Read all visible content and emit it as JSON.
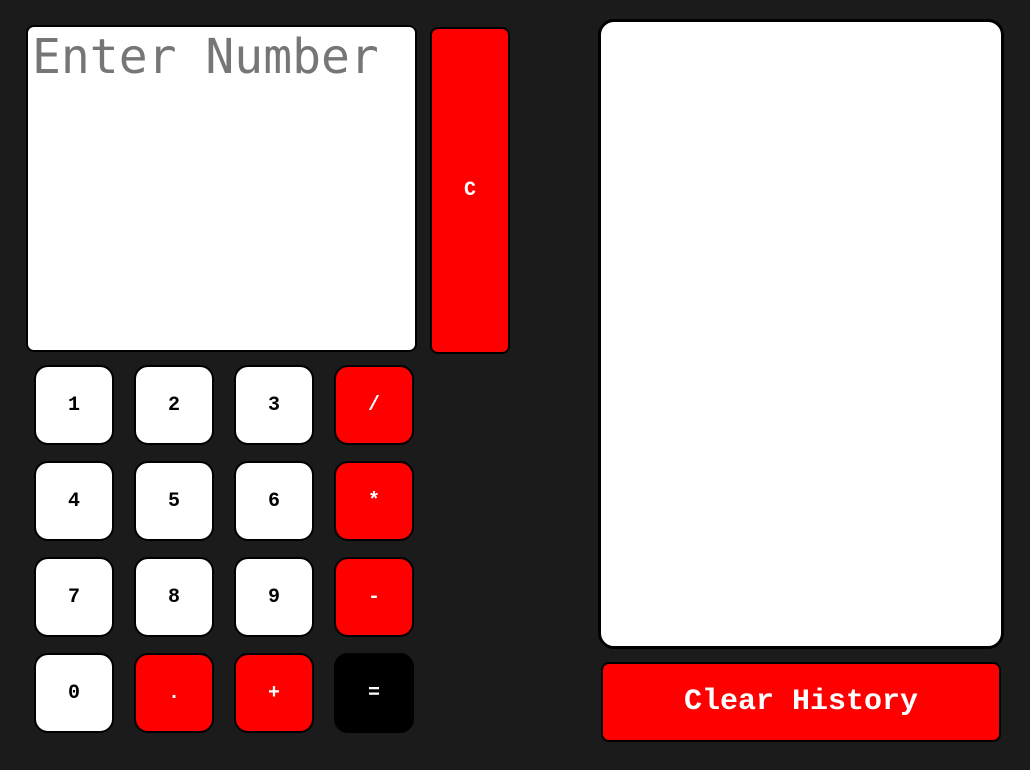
{
  "display": {
    "value": "",
    "placeholder": "Enter Number"
  },
  "clear_button": {
    "label": "C"
  },
  "keypad": {
    "rows": [
      [
        {
          "label": "1",
          "kind": "num"
        },
        {
          "label": "2",
          "kind": "num"
        },
        {
          "label": "3",
          "kind": "num"
        },
        {
          "label": "/",
          "kind": "op"
        }
      ],
      [
        {
          "label": "4",
          "kind": "num"
        },
        {
          "label": "5",
          "kind": "num"
        },
        {
          "label": "6",
          "kind": "num"
        },
        {
          "label": "*",
          "kind": "op"
        }
      ],
      [
        {
          "label": "7",
          "kind": "num"
        },
        {
          "label": "8",
          "kind": "num"
        },
        {
          "label": "9",
          "kind": "num"
        },
        {
          "label": "-",
          "kind": "op"
        }
      ],
      [
        {
          "label": "0",
          "kind": "num"
        },
        {
          "label": ".",
          "kind": "op"
        },
        {
          "label": "+",
          "kind": "op"
        },
        {
          "label": "=",
          "kind": "eq"
        }
      ]
    ]
  },
  "history": {
    "entries": []
  },
  "clear_history_button": {
    "label": "Clear History"
  },
  "colors": {
    "background": "#1b1b1b",
    "accent": "#ff0000",
    "key_light": "#ffffff",
    "key_dark": "#000000",
    "placeholder": "#767676"
  }
}
